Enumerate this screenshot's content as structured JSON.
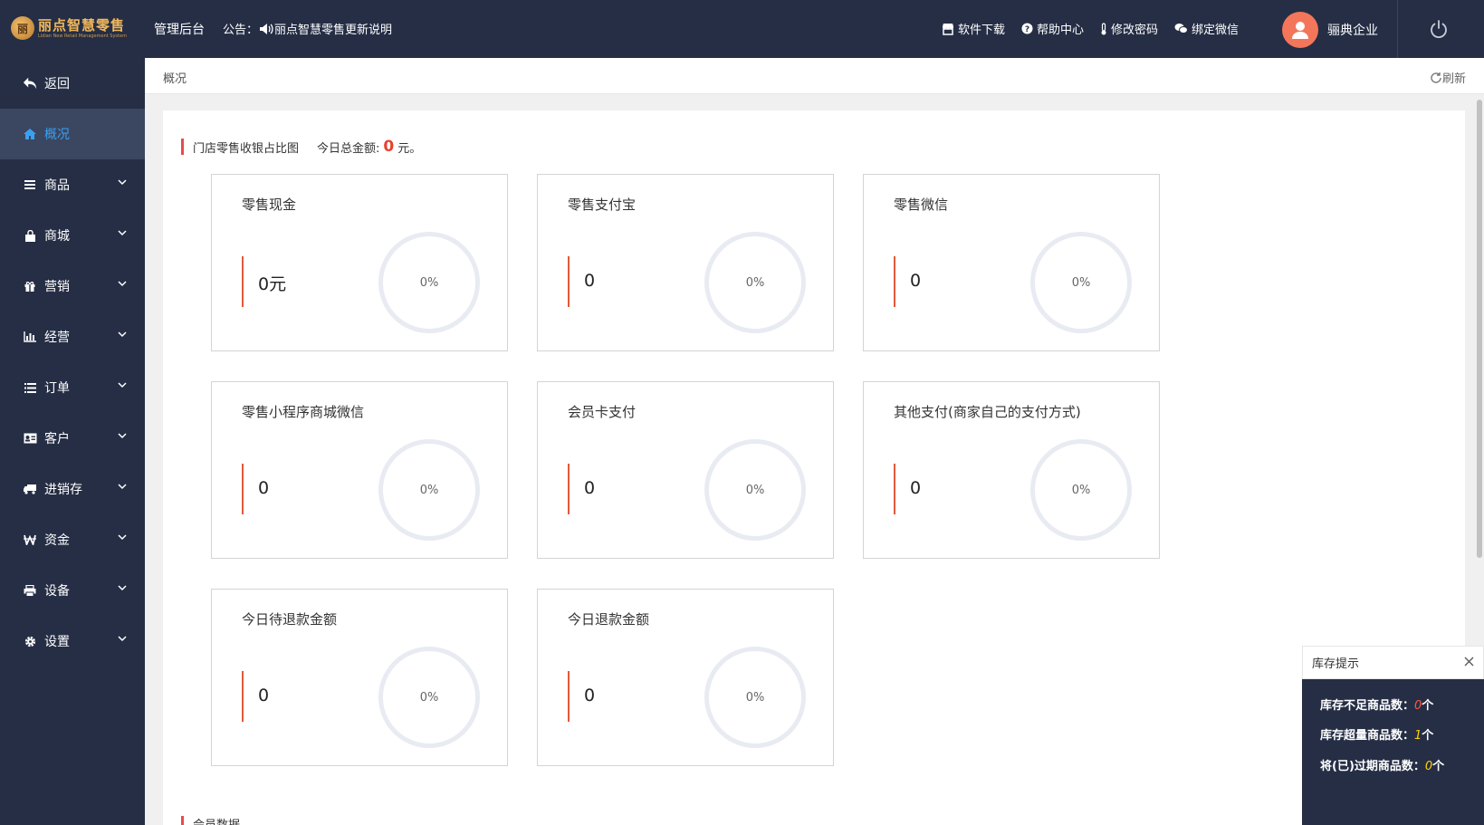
{
  "header": {
    "logo_text": "丽点智慧零售",
    "logo_subtext": "Lidian New Retail Management System",
    "admin_title": "管理后台",
    "notice_label": "公告：",
    "notice_text": "丽点智慧零售更新说明",
    "links": [
      {
        "label": "软件下载",
        "icon": "store-icon"
      },
      {
        "label": "帮助中心",
        "icon": "help-circle-icon"
      },
      {
        "label": "修改密码",
        "icon": "thermometer-icon"
      },
      {
        "label": "绑定微信",
        "icon": "wechat-icon"
      }
    ],
    "user_name": "骊典企业"
  },
  "sidebar": {
    "items": [
      {
        "label": "返回",
        "icon": "back-arrow-icon"
      },
      {
        "label": "概况",
        "icon": "home-icon"
      },
      {
        "label": "商品",
        "icon": "list-icon"
      },
      {
        "label": "商城",
        "icon": "shopping-bag-icon"
      },
      {
        "label": "营销",
        "icon": "gift-icon"
      },
      {
        "label": "经营",
        "icon": "bar-chart-icon"
      },
      {
        "label": "订单",
        "icon": "list-icon"
      },
      {
        "label": "客户",
        "icon": "id-card-icon"
      },
      {
        "label": "进销存",
        "icon": "truck-icon"
      },
      {
        "label": "资金",
        "icon": "currency-icon"
      },
      {
        "label": "设备",
        "icon": "printer-icon"
      },
      {
        "label": "设置",
        "icon": "gear-icon"
      }
    ]
  },
  "breadcrumb": {
    "current": "概况",
    "refresh_label": "刷新"
  },
  "section": {
    "title": "门店零售收银占比图",
    "total_label": "今日总金额:",
    "total_value": "0",
    "total_unit": "元。"
  },
  "cards": [
    {
      "title": "零售现金",
      "value": "0元",
      "percent": "0%"
    },
    {
      "title": "零售支付宝",
      "value": "0",
      "percent": "0%"
    },
    {
      "title": "零售微信",
      "value": "0",
      "percent": "0%"
    },
    {
      "title": "零售小程序商城微信",
      "value": "0",
      "percent": "0%"
    },
    {
      "title": "会员卡支付",
      "value": "0",
      "percent": "0%"
    },
    {
      "title": "其他支付(商家自己的支付方式)",
      "value": "0",
      "percent": "0%"
    },
    {
      "title": "今日待退款金额",
      "value": "0",
      "percent": "0%"
    },
    {
      "title": "今日退款金额",
      "value": "0",
      "percent": "0%"
    }
  ],
  "section2": {
    "title": "会员数据"
  },
  "stock_popup": {
    "title": "库存提示",
    "lines": [
      {
        "label": "库存不足商品数：",
        "count": "0",
        "unit": "个"
      },
      {
        "label": "库存超量商品数：",
        "count": "1",
        "unit": "个"
      },
      {
        "label": "将(已)过期商品数：",
        "count": "0",
        "unit": "个"
      }
    ]
  },
  "colors": {
    "sidebar_bg": "#252e45",
    "active_text": "#3aa0f3",
    "accent_red": "#e84b4b",
    "total_value": "#e8412e"
  }
}
